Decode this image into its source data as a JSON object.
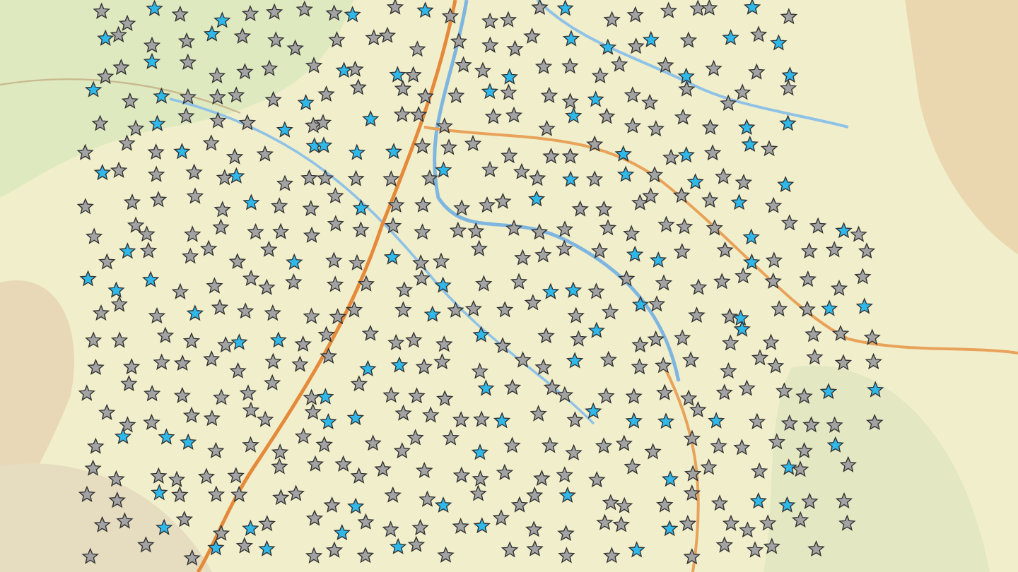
{
  "map": {
    "marker_kinds": [
      {
        "color": "#a3a3a3"
      },
      {
        "color": "#2fb8ea"
      }
    ]
  }
}
